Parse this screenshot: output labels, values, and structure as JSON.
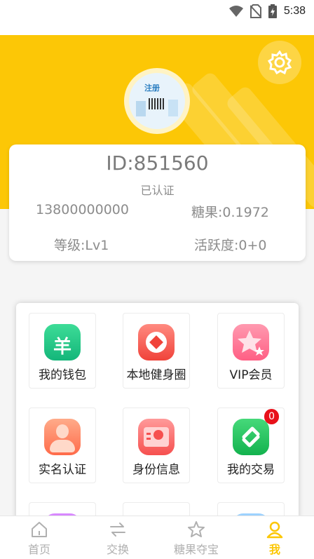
{
  "status_bar": {
    "time": "5:38"
  },
  "header": {
    "accent_color": "#fcc706",
    "avatar_caption": "注册"
  },
  "profile": {
    "id_text": "ID:851560",
    "verified_text": "已认证",
    "phone": "13800000000",
    "candy_text": "糖果:0.1972",
    "level_text": "等级:Lv1",
    "activity_text": "活跃度:0+0"
  },
  "menu": {
    "items": [
      {
        "label": "我的钱包",
        "icon": "wallet-icon"
      },
      {
        "label": "本地健身圈",
        "icon": "fitness-circle-icon"
      },
      {
        "label": "VIP会员",
        "icon": "vip-star-icon"
      },
      {
        "label": "实名认证",
        "icon": "real-name-icon"
      },
      {
        "label": "身份信息",
        "icon": "id-card-icon"
      },
      {
        "label": "我的交易",
        "icon": "trade-icon",
        "badge": "0"
      }
    ]
  },
  "tabbar": {
    "tabs": [
      {
        "label": "首页",
        "icon": "home-icon"
      },
      {
        "label": "交换",
        "icon": "exchange-icon"
      },
      {
        "label": "糖果夺宝",
        "icon": "star-icon"
      },
      {
        "label": "我",
        "icon": "user-icon",
        "active": true
      }
    ]
  }
}
